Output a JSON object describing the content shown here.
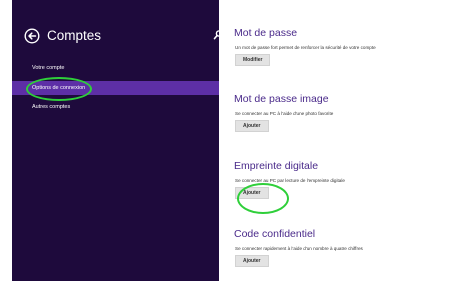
{
  "sidebar": {
    "title": "Comptes",
    "back_icon": "back-arrow-circle-icon",
    "search_icon": "search-icon",
    "items": [
      {
        "label": "Votre compte",
        "selected": false
      },
      {
        "label": "Options de connexion",
        "selected": true
      },
      {
        "label": "Autres comptes",
        "selected": false
      }
    ]
  },
  "sections": [
    {
      "title": "Mot de passe",
      "description": "Un mot de passe fort permet de renforcer la sécurité de votre compte",
      "button": "Modifier"
    },
    {
      "title": "Mot de passe image",
      "description": "Se connecter au PC à l'aide d'une photo favorite",
      "button": "Ajouter"
    },
    {
      "title": "Empreinte digitale",
      "description": "Se connecter au PC par lecture de l'empreinte digitale",
      "button": "Ajouter"
    },
    {
      "title": "Code confidentiel",
      "description": "Se connecter rapidement à l'aide d'un nombre à quatre chiffres",
      "button": "Ajouter"
    }
  ],
  "colors": {
    "sidebar_bg": "#1e0a3c",
    "selected_bg": "#5d2fa6",
    "title_purple": "#4a2a8a",
    "highlight_green": "#2fcf3a"
  }
}
